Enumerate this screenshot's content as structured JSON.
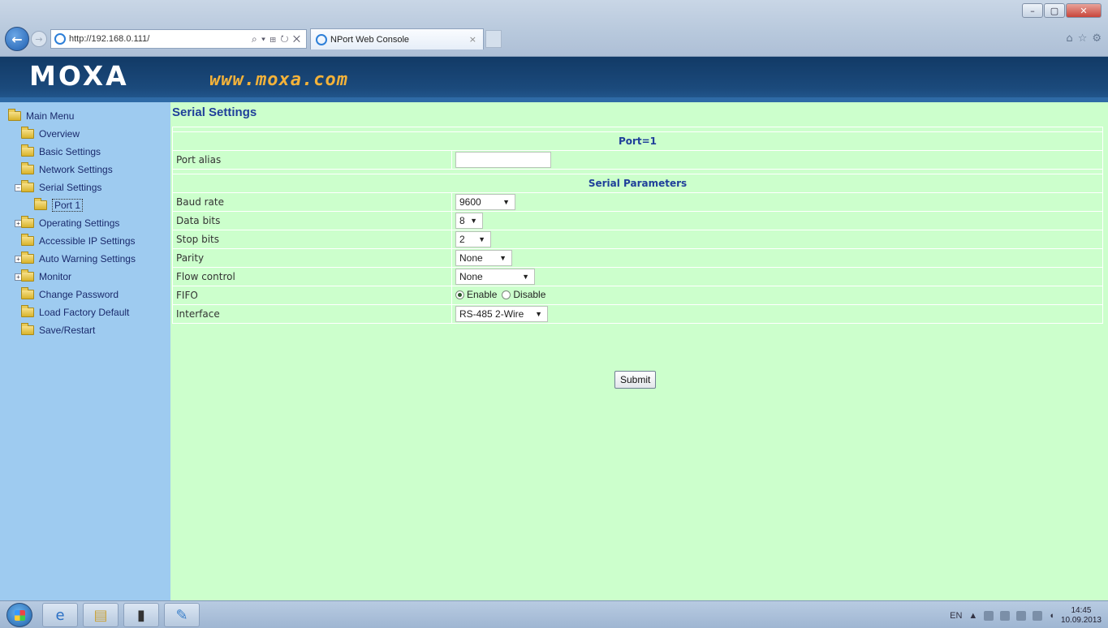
{
  "browser": {
    "url": "http://192.168.0.111/",
    "address_tools": "⌕ ▾ ⊞ ↻ ✕",
    "tab_title": "NPort Web Console",
    "tab_close": "×",
    "window": {
      "minimize": "–",
      "maximize": "▢",
      "close": "✕"
    },
    "favbar": [
      "⌂",
      "☆",
      "⚙"
    ]
  },
  "banner": {
    "logo": "MOXA",
    "site": "www.moxa.com"
  },
  "menu": {
    "items": [
      {
        "label": "Main Menu",
        "icon": "folder-open-icon",
        "expander": ""
      },
      {
        "label": "Overview",
        "icon": "folder-icon",
        "expander": ""
      },
      {
        "label": "Basic Settings",
        "icon": "folder-icon",
        "expander": ""
      },
      {
        "label": "Network Settings",
        "icon": "folder-icon",
        "expander": ""
      },
      {
        "label": "Serial Settings",
        "icon": "folder-open-icon",
        "expander": "−"
      },
      {
        "label": "Port 1",
        "icon": "folder-icon",
        "expander": ""
      },
      {
        "label": "Operating Settings",
        "icon": "folder-icon",
        "expander": "+"
      },
      {
        "label": "Accessible IP Settings",
        "icon": "folder-icon",
        "expander": ""
      },
      {
        "label": "Auto Warning Settings",
        "icon": "folder-icon",
        "expander": "+"
      },
      {
        "label": "Monitor",
        "icon": "folder-icon",
        "expander": "+"
      },
      {
        "label": "Change Password",
        "icon": "folder-icon",
        "expander": ""
      },
      {
        "label": "Load Factory Default",
        "icon": "folder-icon",
        "expander": ""
      },
      {
        "label": "Save/Restart",
        "icon": "folder-icon",
        "expander": ""
      }
    ]
  },
  "content": {
    "title": "Serial Settings",
    "port_header": "Port=1",
    "port_alias": {
      "label": "Port alias",
      "value": ""
    },
    "params_header": "Serial Parameters",
    "baud_rate": {
      "label": "Baud rate",
      "value": "9600"
    },
    "data_bits": {
      "label": "Data bits",
      "value": "8"
    },
    "stop_bits": {
      "label": "Stop bits",
      "value": "2"
    },
    "parity": {
      "label": "Parity",
      "value": "None"
    },
    "flow_control": {
      "label": "Flow control",
      "value": "None"
    },
    "fifo": {
      "label": "FIFO",
      "enable": "Enable",
      "disable": "Disable",
      "selected": "Enable"
    },
    "interface": {
      "label": "Interface",
      "value": "RS-485 2-Wire"
    },
    "submit": "Submit"
  },
  "taskbar": {
    "lang": "EN",
    "time": "14:45",
    "date": "10.09.2013"
  },
  "colors": {
    "banner": "#1b4a7c",
    "sidebar": "#9ecbf0",
    "content": "#ccffcc",
    "heading": "#1f3f9a",
    "site_url": "#f3b23a"
  }
}
